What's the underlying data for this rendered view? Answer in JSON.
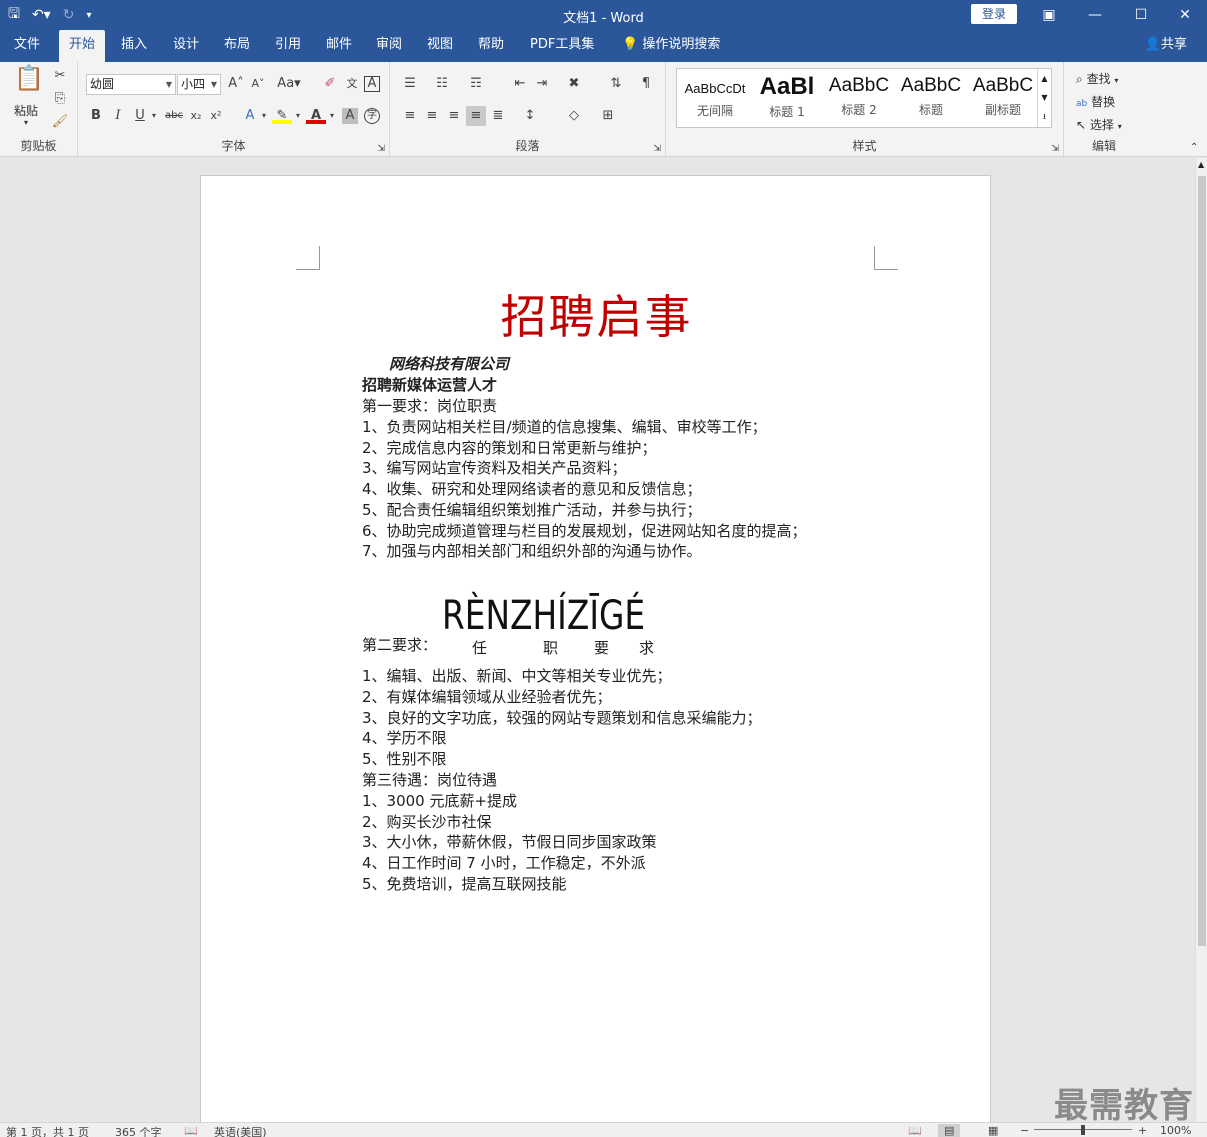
{
  "window": {
    "title": "文档1 - Word",
    "login_label": "登录"
  },
  "tabs": [
    "文件",
    "开始",
    "插入",
    "设计",
    "布局",
    "引用",
    "邮件",
    "审阅",
    "视图",
    "帮助",
    "PDF工具集",
    "操作说明搜索"
  ],
  "share_label": "共享",
  "ribbon": {
    "clipboard": {
      "paste": "粘贴",
      "label": "剪贴板"
    },
    "font": {
      "name": "幼圆",
      "size": "小四",
      "label": "字体"
    },
    "paragraph": {
      "label": "段落"
    },
    "styles": {
      "label": "样式",
      "items": [
        {
          "sample": "AaBbCcDt",
          "name": "无间隔"
        },
        {
          "sample": "AaBl",
          "name": "标题 1"
        },
        {
          "sample": "AaBbC",
          "name": "标题 2"
        },
        {
          "sample": "AaBbC",
          "name": "标题"
        },
        {
          "sample": "AaBbC",
          "name": "副标题"
        }
      ]
    },
    "editing": {
      "label": "编辑",
      "find": "查找",
      "replace": "替换",
      "select": "选择"
    }
  },
  "document": {
    "title": "招聘启事",
    "company": "网络科技有限公司",
    "heading": "招聘新媒体运营人才",
    "section1_title": "第一要求：岗位职责",
    "section1_items": [
      "1、负责网站相关栏目/频道的信息搜集、编辑、审校等工作；",
      "2、完成信息内容的策划和日常更新与维护；",
      "3、编写网站宣传资料及相关产品资料；",
      "4、收集、研究和处理网络读者的意见和反馈信息；",
      "5、配合责任编辑组织策划推广活动，并参与执行；",
      "6、协助完成频道管理与栏目的发展规划，促进网站知名度的提高；",
      "7、加强与内部相关部门和组织外部的沟通与协作。"
    ],
    "section2_prefix": "第二要求：",
    "section2_pinyin": "RÈNZHÍZĪGÉ",
    "section2_chars": [
      "任",
      "职",
      "要",
      "求"
    ],
    "section2_items": [
      "1、编辑、出版、新闻、中文等相关专业优先；",
      "2、有媒体编辑领域从业经验者优先；",
      "3、良好的文字功底，较强的网站专题策划和信息采编能力；",
      "4、学历不限",
      "5、性别不限"
    ],
    "section3_title": "第三待遇：岗位待遇",
    "section3_items": [
      "1、3000 元底薪+提成",
      "2、购买长沙市社保",
      "3、大小休，带薪休假，节假日同步国家政策",
      "4、日工作时间 7 小时，工作稳定，不外派",
      "5、免费培训，提高互联网技能"
    ]
  },
  "statusbar": {
    "page": "第 1 页，共 1 页",
    "words": "365 个字",
    "language": "英语(美国)",
    "zoom": "100%"
  },
  "watermark": "最需教育"
}
